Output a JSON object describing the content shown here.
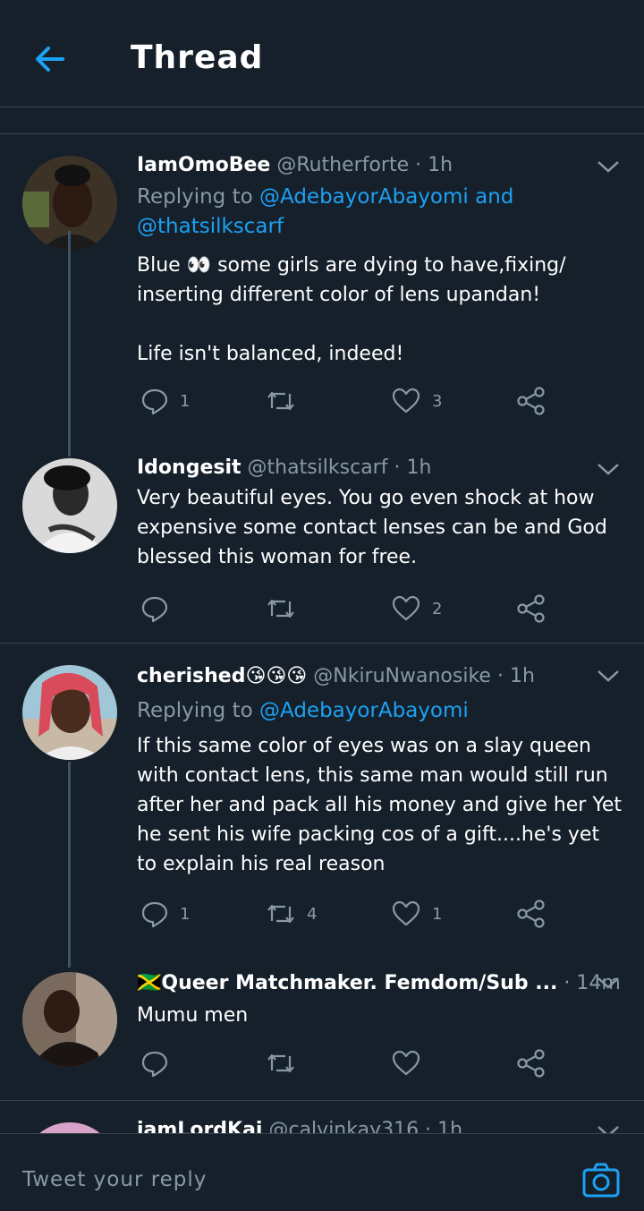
{
  "header": {
    "title": "Thread"
  },
  "tweets": [
    {
      "name": "IamOmoBee",
      "handle": "@Rutherforte",
      "time": "1h",
      "replying_prefix": "Replying to",
      "replying_to": [
        "@AdebayorAbayomi",
        "@thatsilkscarf"
      ],
      "replying_and": "and",
      "text": "Blue 👀 some girls are dying to have,fixing/\ninserting different color of lens upandan!\n\nLife isn't balanced, indeed!",
      "replies": "1",
      "retweets": "",
      "likes": "3"
    },
    {
      "name": "Idongesit",
      "handle": "@thatsilkscarf",
      "time": "1h",
      "text": "Very beautiful eyes. You go even shock at how expensive some contact lenses can be and God blessed this woman for free.",
      "replies": "",
      "retweets": "",
      "likes": "2"
    },
    {
      "name": "cherished😘😘😘",
      "handle": "@NkiruNwanosike",
      "time": "1h",
      "replying_prefix": "Replying to",
      "replying_to": [
        "@AdebayorAbayomi"
      ],
      "text": "If this same color of eyes was on a slay queen with contact lens, this same man would still run after her and pack all his money and give her Yet he sent his wife packing cos of a gift....he's yet to explain his real reason",
      "replies": "1",
      "retweets": "4",
      "likes": "1"
    },
    {
      "name": "🇯🇲Queer Matchmaker. Femdom/Sub ...",
      "handle": "",
      "time": "14m",
      "text": "Mumu men",
      "replies": "",
      "retweets": "",
      "likes": ""
    },
    {
      "name": "iamLordKai",
      "handle": "@calvinkay316",
      "time": "1h"
    }
  ],
  "composer": {
    "placeholder": "Tweet your reply"
  },
  "colors": {
    "background": "#15202b",
    "link": "#1da1f2",
    "muted": "#8899a6",
    "divider": "#38444d"
  },
  "icons": [
    "back-arrow-icon",
    "reply-icon",
    "retweet-icon",
    "like-icon",
    "share-icon",
    "chevron-down-icon",
    "camera-icon"
  ]
}
